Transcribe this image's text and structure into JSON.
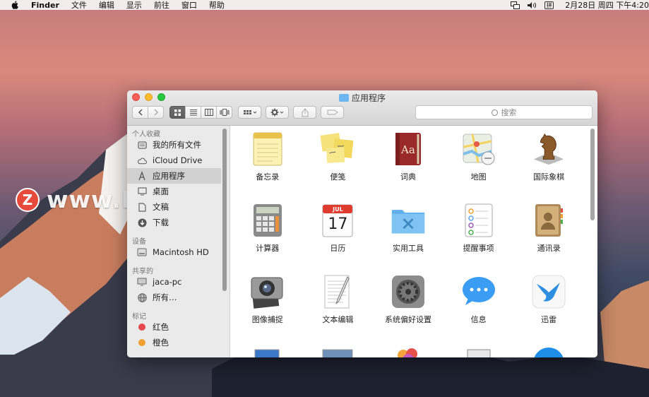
{
  "menubar": {
    "app_name": "Finder",
    "items": [
      "文件",
      "编辑",
      "显示",
      "前往",
      "窗口",
      "帮助"
    ],
    "input_method": "拼",
    "clock": "2月28日 周四 下午4:20"
  },
  "watermark": {
    "logo_letter": "Z",
    "text": "www.MacZ.com"
  },
  "window": {
    "title": "应用程序",
    "search_placeholder": "搜索"
  },
  "sidebar": {
    "sections": [
      {
        "header": "个人收藏",
        "items": [
          "我的所有文件",
          "iCloud Drive",
          "应用程序",
          "桌面",
          "文稿",
          "下载"
        ]
      },
      {
        "header": "设备",
        "items": [
          "Macintosh HD"
        ]
      },
      {
        "header": "共享的",
        "items": [
          "jaca-pc",
          "所有…"
        ]
      },
      {
        "header": "标记",
        "items": [
          "红色",
          "橙色"
        ]
      }
    ],
    "selected": "应用程序"
  },
  "apps": [
    "备忘录",
    "便笺",
    "词典",
    "地图",
    "国际象棋",
    "计算器",
    "日历",
    "实用工具",
    "提醒事项",
    "通讯录",
    "图像捕捉",
    "文本编辑",
    "系统偏好设置",
    "信息",
    "迅雷"
  ],
  "calendar_icon": {
    "month": "JUL",
    "day": "17"
  },
  "dictionary_icon": {
    "text": "Aa"
  },
  "colors": {
    "tag_red": "#e5484d",
    "tag_orange": "#f0a030",
    "folder_blue": "#6cb6f2"
  }
}
